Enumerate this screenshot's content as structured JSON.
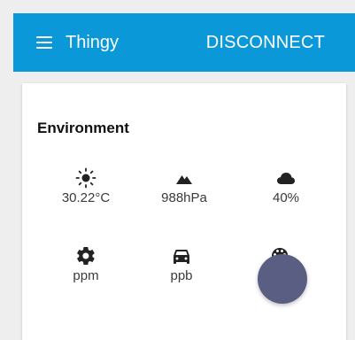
{
  "appbar": {
    "title": "Thingy",
    "disconnect_label": "DISCONNECT",
    "color": "#0a98d8"
  },
  "environment": {
    "title": "Environment",
    "sensors": [
      {
        "icon": "sun-icon",
        "value": "30.22°C"
      },
      {
        "icon": "mountain-icon",
        "value": "988hPa"
      },
      {
        "icon": "cloud-icon",
        "value": "40%"
      },
      {
        "icon": "gear-icon",
        "value": "ppm"
      },
      {
        "icon": "car-icon",
        "value": "ppb"
      },
      {
        "icon": "palette-icon",
        "value": ""
      }
    ]
  },
  "fab": {
    "color": "#5a5e82"
  }
}
